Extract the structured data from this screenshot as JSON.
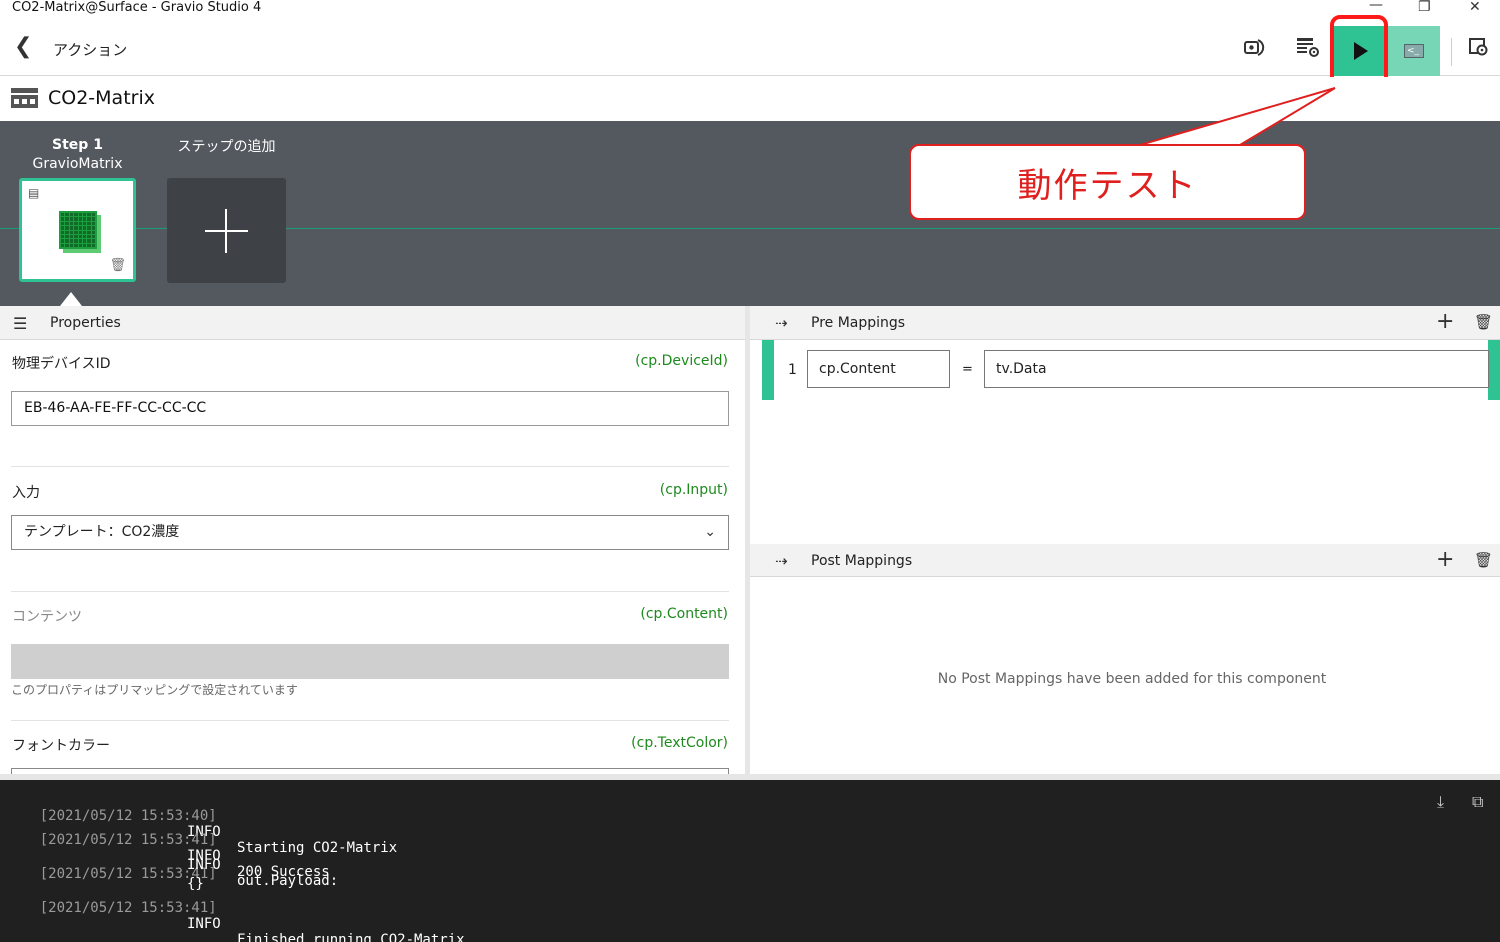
{
  "window": {
    "title": "CO2-Matrix@Surface - Gravio Studio 4",
    "minimize": "—",
    "restore": "❐",
    "close": "✕"
  },
  "toolbar": {
    "back_label": "アクション",
    "run_icon": "play-icon",
    "console_icon": "console-icon"
  },
  "action": {
    "name": "CO2-Matrix"
  },
  "steps": {
    "items": [
      {
        "title": "Step 1",
        "component": "GravioMatrix"
      }
    ],
    "add_label": "ステップの追加"
  },
  "callout": {
    "text": "動作テスト",
    "color": "#e01f1f"
  },
  "properties": {
    "header": "Properties",
    "fields": [
      {
        "label": "物理デバイスID",
        "key": "(cp.DeviceId)",
        "value": "EB-46-AA-FE-FF-CC-CC-CC"
      },
      {
        "label": "入力",
        "key": "(cp.Input)",
        "value": "テンプレート：CO2濃度"
      },
      {
        "label": "コンテンツ",
        "key": "(cp.Content)",
        "value": "",
        "hint": "このプロパティはプリマッピングで設定されています"
      },
      {
        "label": "フォントカラー",
        "key": "(cp.TextColor)"
      }
    ]
  },
  "pre_mappings": {
    "header": "Pre Mappings",
    "rows": [
      {
        "index": "1",
        "target": "cp.Content",
        "op": "=",
        "source": "tv.Data"
      }
    ]
  },
  "post_mappings": {
    "header": "Post Mappings",
    "empty_message": "No Post Mappings have been added for this component"
  },
  "log": {
    "lines": [
      {
        "ts": "[2021/05/12 15:53:40]",
        "level": "INFO",
        "msg": "Starting CO2-Matrix"
      },
      {
        "ts": "[2021/05/12 15:53:41]",
        "level": "INFO",
        "msg": "200 Success"
      },
      {
        "ts": "[2021/05/12 15:53:41]",
        "level": "INFO",
        "msg": "out.Payload:",
        "msg2": "{}"
      },
      {
        "ts": "[2021/05/12 15:53:41]",
        "level": "INFO",
        "msg": "Finished running CO2-Matrix"
      }
    ]
  },
  "colors": {
    "accent": "#2fc293",
    "highlight": "#ff1a1a",
    "key_green": "#1e8a1e",
    "steps_bg": "#545960",
    "log_bg": "#202020"
  }
}
